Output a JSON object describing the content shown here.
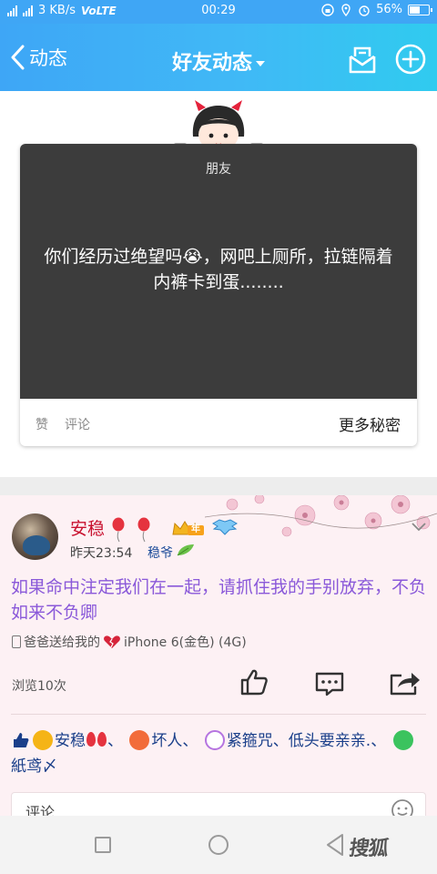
{
  "status_bar": {
    "network_speed": "3 KB/s",
    "volte": "VoLTE",
    "time": "00:29",
    "battery": "56%",
    "battery_level": 0.56
  },
  "header": {
    "back_label": "动态",
    "title": "好友动态",
    "bg_colors": [
      "#3ea6f6",
      "#30cbef"
    ]
  },
  "secret_card": {
    "tag": "朋友",
    "text": "你们经历过绝望吗😭，网吧上厕所，拉链隔着内裤卡到蛋........",
    "like_label": "赞",
    "comment_label": "评论",
    "more_label": "更多秘密"
  },
  "post": {
    "name": "安稳",
    "vip_badge": "年",
    "time": "昨天23:54",
    "client": "稳爷",
    "text": "如果命中注定我们在一起，请抓住我的手别放弃，不负如来不负卿",
    "device_prefix": "爸爸送给我的",
    "device_model": "iPhone 6(金色) (4G)",
    "views": "浏览10次",
    "likers": [
      {
        "name": "安稳",
        "suffix": "、"
      },
      {
        "name": "坏人",
        "suffix": "、"
      },
      {
        "name": "紧箍咒、低头要亲亲.",
        "suffix": "、"
      },
      {
        "name": "紙鸢〆",
        "suffix": ""
      }
    ],
    "comment_placeholder": "评论"
  },
  "nav_bar": {
    "watermark": "搜狐"
  },
  "icons": {
    "back": "chevron-left-icon",
    "mail": "mailbox-icon",
    "add": "plus-circle-icon",
    "like": "thumbs-up-icon",
    "comment": "comment-bubble-icon",
    "share": "share-icon",
    "emoji": "smiley-icon"
  }
}
